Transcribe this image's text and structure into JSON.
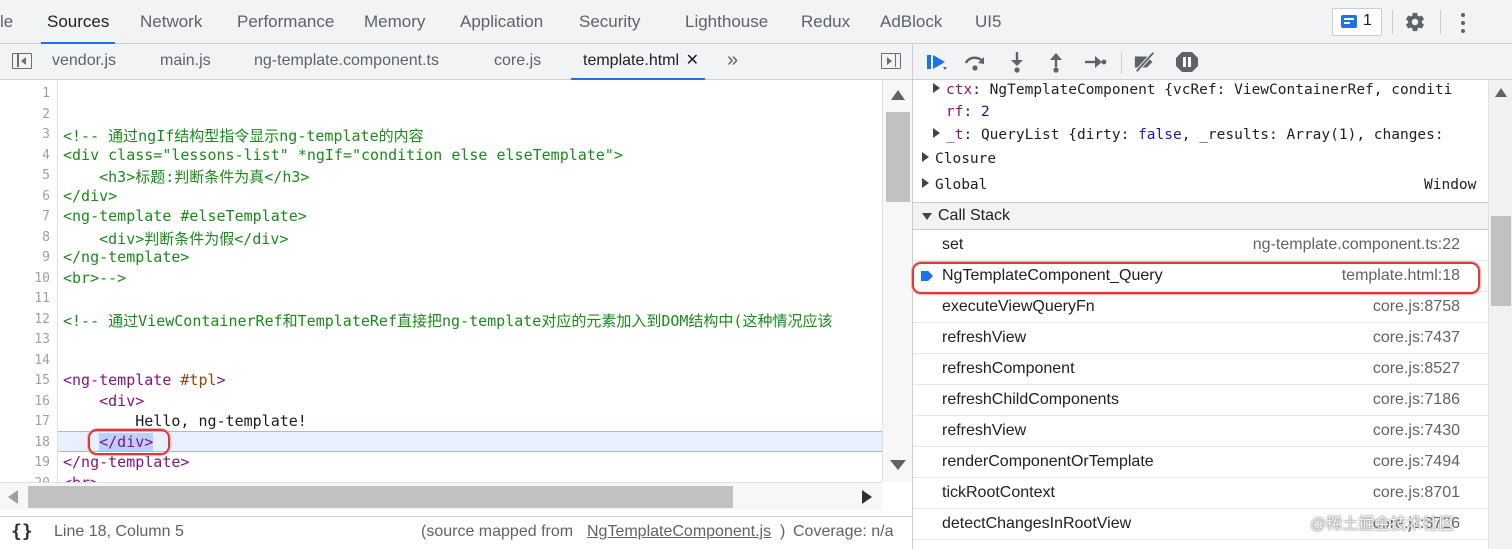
{
  "panel_tabs": [
    {
      "label": "le",
      "active": false
    },
    {
      "label": "Sources",
      "active": true
    },
    {
      "label": "Network",
      "active": false
    },
    {
      "label": "Performance",
      "active": false
    },
    {
      "label": "Memory",
      "active": false
    },
    {
      "label": "Application",
      "active": false
    },
    {
      "label": "Security",
      "active": false
    },
    {
      "label": "Lighthouse",
      "active": false
    },
    {
      "label": "Redux",
      "active": false
    },
    {
      "label": "AdBlock",
      "active": false
    },
    {
      "label": "UI5",
      "active": false
    }
  ],
  "issues": {
    "count": "1",
    "icon": "issues-icon"
  },
  "file_tabs": [
    {
      "label": "vendor.js",
      "active": false
    },
    {
      "label": "main.js",
      "active": false
    },
    {
      "label": "ng-template.component.ts",
      "active": false
    },
    {
      "label": "core.js",
      "active": false
    },
    {
      "label": "template.html",
      "active": true
    }
  ],
  "file_tab_close": "✕",
  "file_tab_more": "»",
  "editor": {
    "current_line": 18,
    "lines": [
      {
        "n": "1",
        "segs": []
      },
      {
        "n": "2",
        "segs": []
      },
      {
        "n": "3",
        "segs": [
          {
            "c": "cmt",
            "t": "<!-- 通过ngIf结构型指令显示ng-template的内容"
          }
        ]
      },
      {
        "n": "4",
        "segs": [
          {
            "c": "cmt",
            "t": "<div class=\"lessons-list\" *ngIf=\"condition else elseTemplate\">"
          }
        ]
      },
      {
        "n": "5",
        "segs": [
          {
            "c": "cmt",
            "t": "    <h3>标题:判断条件为真</h3>"
          }
        ]
      },
      {
        "n": "6",
        "segs": [
          {
            "c": "cmt",
            "t": "</div>"
          }
        ]
      },
      {
        "n": "7",
        "segs": [
          {
            "c": "cmt",
            "t": "<ng-template #elseTemplate>"
          }
        ]
      },
      {
        "n": "8",
        "segs": [
          {
            "c": "cmt",
            "t": "    <div>判断条件为假</div>"
          }
        ]
      },
      {
        "n": "9",
        "segs": [
          {
            "c": "cmt",
            "t": "</ng-template>"
          }
        ]
      },
      {
        "n": "10",
        "segs": [
          {
            "c": "cmt",
            "t": "<br>-->"
          }
        ]
      },
      {
        "n": "11",
        "segs": []
      },
      {
        "n": "12",
        "segs": [
          {
            "c": "cmt",
            "t": "<!-- 通过ViewContainerRef和TemplateRef直接把ng-template对应的元素加入到DOM结构中(这种情况应该"
          }
        ]
      },
      {
        "n": "13",
        "segs": []
      },
      {
        "n": "14",
        "segs": []
      },
      {
        "n": "15",
        "segs": [
          {
            "c": "tg",
            "t": "<ng-template "
          },
          {
            "c": "an",
            "t": "#tpl"
          },
          {
            "c": "tg",
            "t": ">"
          }
        ]
      },
      {
        "n": "16",
        "segs": [
          {
            "c": "",
            "t": "    "
          },
          {
            "c": "tg",
            "t": "<div>"
          }
        ]
      },
      {
        "n": "17",
        "segs": [
          {
            "c": "",
            "t": "        Hello, ng-template!"
          }
        ]
      },
      {
        "n": "18",
        "segs": [
          {
            "c": "",
            "t": "    "
          },
          {
            "c": "tg sel",
            "t": "</div>"
          }
        ]
      },
      {
        "n": "19",
        "segs": [
          {
            "c": "tg",
            "t": "</ng-template>"
          }
        ]
      },
      {
        "n": "20",
        "segs": [
          {
            "c": "tg",
            "t": "<br>"
          }
        ]
      }
    ]
  },
  "status": {
    "braces": "{}",
    "position": "Line 18, Column 5",
    "source_mapped_prefix": "(source mapped from ",
    "source_mapped_file": "NgTemplateComponent.js",
    "source_mapped_suffix": ")",
    "coverage": "Coverage: n/a"
  },
  "scope": {
    "ctx_key": "ctx",
    "ctx_value": "NgTemplateComponent {vcRef: ViewContainerRef, conditi",
    "rf_key": "rf",
    "rf_value": "2",
    "t_key": "_t",
    "t_value_a": "QueryList {dirty: ",
    "t_value_kw": "false",
    "t_value_b": ", _results: Array(1), changes: ",
    "closure": "Closure",
    "global": "Global",
    "global_value": "Window"
  },
  "call_stack": {
    "title": "Call Stack",
    "frames": [
      {
        "fn": "set",
        "loc": "ng-template.component.ts:22",
        "current": false
      },
      {
        "fn": "NgTemplateComponent_Query",
        "loc": "template.html:18",
        "current": true
      },
      {
        "fn": "executeViewQueryFn",
        "loc": "core.js:8758",
        "current": false
      },
      {
        "fn": "refreshView",
        "loc": "core.js:7437",
        "current": false
      },
      {
        "fn": "refreshComponent",
        "loc": "core.js:8527",
        "current": false
      },
      {
        "fn": "refreshChildComponents",
        "loc": "core.js:7186",
        "current": false
      },
      {
        "fn": "refreshView",
        "loc": "core.js:7430",
        "current": false
      },
      {
        "fn": "renderComponentOrTemplate",
        "loc": "core.js:7494",
        "current": false
      },
      {
        "fn": "tickRootContext",
        "loc": "core.js:8701",
        "current": false
      },
      {
        "fn": "detectChangesInRootView",
        "loc": "core.js:8726",
        "current": false
      }
    ]
  },
  "watermark": "@稀土掘金技术社区",
  "colors": {
    "accent": "#1a73e8",
    "annotation_ring": "#d93a3a",
    "comment": "#1b8a1b",
    "tag": "#881280"
  }
}
